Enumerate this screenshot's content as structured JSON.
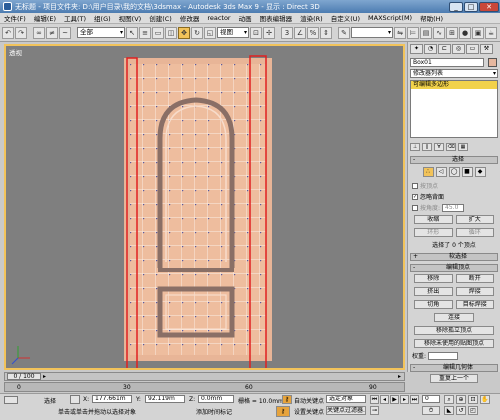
{
  "titlebar": {
    "title": "无标题  - 项目文件夹: D:\\用户目录\\我的文档\\3dsmax  - Autodesk 3ds Max 9  - 显示 : Direct 3D",
    "minimize": "_",
    "maximize": "□",
    "close": "✕"
  },
  "menu": [
    "文件(F)",
    "编辑(E)",
    "工具(T)",
    "组(G)",
    "视图(V)",
    "创建(C)",
    "修改器",
    "reactor",
    "动画",
    "图表编辑器",
    "渲染(R)",
    "自定义(U)",
    "MAXScript(M)",
    "帮助(H)"
  ],
  "toolbar": {
    "selection_filter": "全部",
    "coord_system": "视图",
    "named_selection": ""
  },
  "viewport": {
    "label": "透视"
  },
  "panel": {
    "object_name": "Box01",
    "modifier_list": "修改器列表",
    "stack_item": "可编辑多边形",
    "selection": {
      "title": "选择",
      "by_vertex": "按顶点",
      "ignore_backfacing": "忽略背面",
      "by_angle": "按角度:",
      "angle_value": "45.0",
      "shrink": "收缩",
      "grow": "扩大",
      "ring": "环形",
      "loop": "循环",
      "info": "选择了 0 个顶点"
    },
    "soft_selection": {
      "title": "软选择"
    },
    "edit_vertices": {
      "title": "编辑顶点",
      "remove": "移除",
      "break": "断开",
      "extrude": "挤出",
      "weld": "焊接",
      "chamfer": "切角",
      "target_weld": "目标焊接",
      "connect": "连接",
      "remove_isolated": "移除孤立顶点",
      "remove_unused_map": "移除未使用的贴图顶点",
      "weight_label": "权重:"
    },
    "edit_geometry": {
      "title": "编辑几何体",
      "repeat_last": "重复上一个"
    }
  },
  "timeslider": {
    "position": "0 / 100"
  },
  "trackbar": {
    "ticks": [
      "0",
      "30",
      "60",
      "90"
    ]
  },
  "status": {
    "select_label": "选择",
    "x_label": "X:",
    "x_value": "177.661m",
    "y_label": "Y:",
    "y_value": "92.119m",
    "z_label": "Z:",
    "z_value": "0.0mm",
    "grid": "栅格 = 10.0mm",
    "auto_key": "自动关键点",
    "selected_object": "选定对象",
    "set_key": "设置关键点",
    "key_filters": "关键点过滤器...",
    "prompt": "单击或单击并拖动以选择对象",
    "add_time_tag": "添加时间标记",
    "frame_value": "0"
  }
}
